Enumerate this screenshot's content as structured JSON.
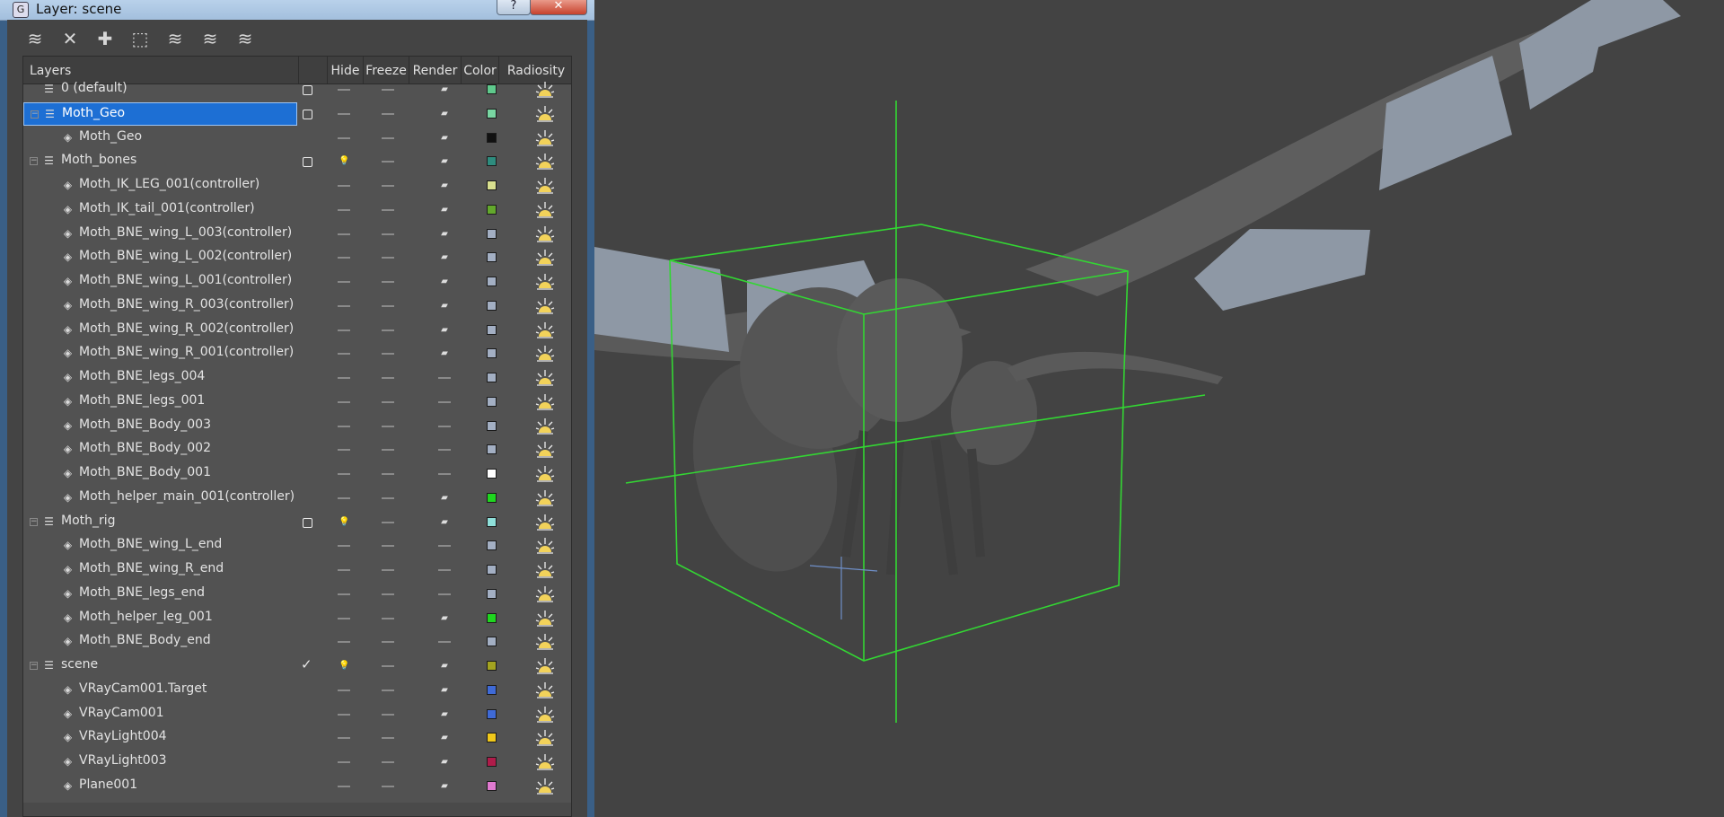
{
  "window": {
    "title": "Layer: scene",
    "help_glyph": "?",
    "close_glyph": "✕",
    "app_glyph": "G"
  },
  "toolbar": {
    "buttons": [
      {
        "name": "new-layer",
        "glyph": "≋"
      },
      {
        "name": "delete-layer",
        "glyph": "✕"
      },
      {
        "name": "add-selection",
        "glyph": "✚"
      },
      {
        "name": "select-objects",
        "glyph": "⬚"
      },
      {
        "name": "highlight-layer",
        "glyph": "≋"
      },
      {
        "name": "hide-all",
        "glyph": "≋"
      },
      {
        "name": "freeze-all",
        "glyph": "≋"
      }
    ]
  },
  "columns": {
    "layers": "Layers",
    "hide": "Hide",
    "freeze": "Freeze",
    "render": "Render",
    "color": "Color",
    "radiosity": "Radiosity"
  },
  "rows": [
    {
      "name": "0 (default)",
      "type": "layer",
      "expanded": false,
      "active": "box",
      "hide_icon": false,
      "color": "#5fc98c",
      "render": true,
      "selected": false
    },
    {
      "name": "Moth_Geo",
      "type": "layer",
      "expanded": true,
      "active": "box",
      "hide_icon": false,
      "color": "#79d6a2",
      "render": true,
      "selected": true
    },
    {
      "name": "Moth_Geo",
      "type": "object",
      "active": "",
      "hide_icon": false,
      "color": "#111111",
      "render": true,
      "selected": false
    },
    {
      "name": "Moth_bones",
      "type": "layer",
      "expanded": true,
      "active": "box",
      "hide_icon": true,
      "color": "#2e8c7e",
      "render": true,
      "selected": false
    },
    {
      "name": "Moth_IK_LEG_001(controller)",
      "type": "object",
      "active": "",
      "hide_icon": false,
      "color": "#d9e08f",
      "render": true,
      "selected": false
    },
    {
      "name": "Moth_IK_tail_001(controller)",
      "type": "object",
      "active": "",
      "hide_icon": false,
      "color": "#63a82c",
      "render": true,
      "selected": false
    },
    {
      "name": "Moth_BNE_wing_L_003(controller)",
      "type": "object",
      "active": "",
      "hide_icon": false,
      "color": "#a3afc3",
      "render": true,
      "selected": false
    },
    {
      "name": "Moth_BNE_wing_L_002(controller)",
      "type": "object",
      "active": "",
      "hide_icon": false,
      "color": "#a3afc3",
      "render": true,
      "selected": false
    },
    {
      "name": "Moth_BNE_wing_L_001(controller)",
      "type": "object",
      "active": "",
      "hide_icon": false,
      "color": "#a3afc3",
      "render": true,
      "selected": false
    },
    {
      "name": "Moth_BNE_wing_R_003(controller)",
      "type": "object",
      "active": "",
      "hide_icon": false,
      "color": "#a3afc3",
      "render": true,
      "selected": false
    },
    {
      "name": "Moth_BNE_wing_R_002(controller)",
      "type": "object",
      "active": "",
      "hide_icon": false,
      "color": "#a3afc3",
      "render": true,
      "selected": false
    },
    {
      "name": "Moth_BNE_wing_R_001(controller)",
      "type": "object",
      "active": "",
      "hide_icon": false,
      "color": "#a3afc3",
      "render": true,
      "selected": false
    },
    {
      "name": "Moth_BNE_legs_004",
      "type": "object",
      "active": "",
      "hide_icon": false,
      "color": "#a3afc3",
      "render": false,
      "selected": false
    },
    {
      "name": "Moth_BNE_legs_001",
      "type": "object",
      "active": "",
      "hide_icon": false,
      "color": "#a3afc3",
      "render": false,
      "selected": false
    },
    {
      "name": "Moth_BNE_Body_003",
      "type": "object",
      "active": "",
      "hide_icon": false,
      "color": "#a3afc3",
      "render": false,
      "selected": false
    },
    {
      "name": "Moth_BNE_Body_002",
      "type": "object",
      "active": "",
      "hide_icon": false,
      "color": "#a3afc3",
      "render": false,
      "selected": false
    },
    {
      "name": "Moth_BNE_Body_001",
      "type": "object",
      "active": "",
      "hide_icon": false,
      "color": "#ffffff",
      "render": false,
      "selected": false
    },
    {
      "name": "Moth_helper_main_001(controller)",
      "type": "object",
      "active": "",
      "hide_icon": false,
      "color": "#1fd61f",
      "render": true,
      "selected": false
    },
    {
      "name": "Moth_rig",
      "type": "layer",
      "expanded": true,
      "active": "box",
      "hide_icon": true,
      "color": "#8fe0da",
      "render": true,
      "selected": false
    },
    {
      "name": "Moth_BNE_wing_L_end",
      "type": "object",
      "active": "",
      "hide_icon": false,
      "color": "#a3afc3",
      "render": false,
      "selected": false
    },
    {
      "name": "Moth_BNE_wing_R_end",
      "type": "object",
      "active": "",
      "hide_icon": false,
      "color": "#a3afc3",
      "render": false,
      "selected": false
    },
    {
      "name": "Moth_BNE_legs_end",
      "type": "object",
      "active": "",
      "hide_icon": false,
      "color": "#a3afc3",
      "render": false,
      "selected": false
    },
    {
      "name": "Moth_helper_leg_001",
      "type": "object",
      "active": "",
      "hide_icon": false,
      "color": "#1fd61f",
      "render": true,
      "selected": false
    },
    {
      "name": "Moth_BNE_Body_end",
      "type": "object",
      "active": "",
      "hide_icon": false,
      "color": "#a3afc3",
      "render": false,
      "selected": false
    },
    {
      "name": "scene",
      "type": "layer",
      "expanded": true,
      "active": "check",
      "hide_icon": true,
      "color": "#a3a320",
      "render": true,
      "selected": false
    },
    {
      "name": "VRayCam001.Target",
      "type": "object",
      "active": "",
      "hide_icon": false,
      "color": "#3f6ad6",
      "render": true,
      "selected": false
    },
    {
      "name": "VRayCam001",
      "type": "object",
      "active": "",
      "hide_icon": false,
      "color": "#3f6ad6",
      "render": true,
      "selected": false
    },
    {
      "name": "VRayLight004",
      "type": "object",
      "active": "",
      "hide_icon": false,
      "color": "#f0c81a",
      "render": true,
      "selected": false
    },
    {
      "name": "VRayLight003",
      "type": "object",
      "active": "",
      "hide_icon": false,
      "color": "#b01c4a",
      "render": true,
      "selected": false
    },
    {
      "name": "Plane001",
      "type": "object",
      "active": "",
      "hide_icon": false,
      "color": "#e07ad0",
      "render": true,
      "selected": false
    }
  ]
}
